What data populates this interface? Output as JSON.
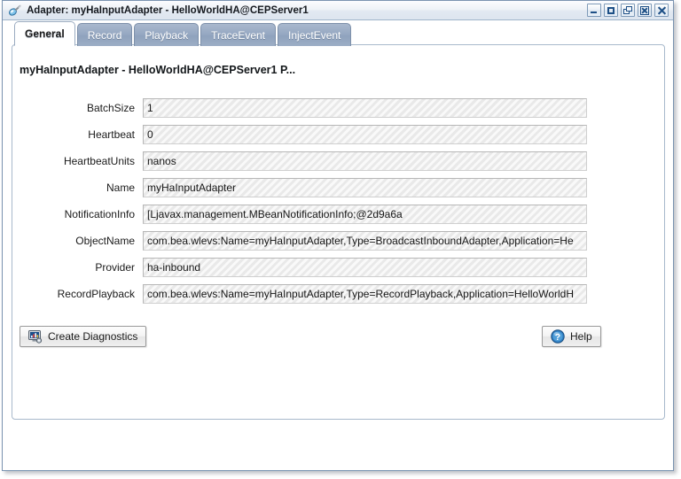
{
  "window": {
    "title": "Adapter: myHaInputAdapter - HelloWorldHA@CEPServer1",
    "icon": "adapter-plug-icon",
    "controls": [
      {
        "name": "minimize",
        "glyph": "minimize-icon"
      },
      {
        "name": "maximize",
        "glyph": "maximize-icon"
      },
      {
        "name": "restore",
        "glyph": "restore-icon"
      },
      {
        "name": "close-boxed",
        "glyph": "close-boxed-icon"
      },
      {
        "name": "close",
        "glyph": "close-icon"
      }
    ]
  },
  "tabs": [
    {
      "label": "General",
      "active": true
    },
    {
      "label": "Record",
      "active": false
    },
    {
      "label": "Playback",
      "active": false
    },
    {
      "label": "TraceEvent",
      "active": false
    },
    {
      "label": "InjectEvent",
      "active": false
    }
  ],
  "panel": {
    "heading": "myHaInputAdapter - HelloWorldHA@CEPServer1 P...",
    "fields": [
      {
        "label": "BatchSize",
        "value": "1"
      },
      {
        "label": "Heartbeat",
        "value": "0"
      },
      {
        "label": "HeartbeatUnits",
        "value": "nanos"
      },
      {
        "label": "Name",
        "value": "myHaInputAdapter"
      },
      {
        "label": "NotificationInfo",
        "value": "[Ljavax.management.MBeanNotificationInfo;@2d9a6a"
      },
      {
        "label": "ObjectName",
        "value": "com.bea.wlevs:Name=myHaInputAdapter,Type=BroadcastInboundAdapter,Application=He"
      },
      {
        "label": "Provider",
        "value": "ha-inbound"
      },
      {
        "label": "RecordPlayback",
        "value": "com.bea.wlevs:Name=myHaInputAdapter,Type=RecordPlayback,Application=HelloWorldH"
      }
    ],
    "buttons": {
      "create_diagnostics": "Create Diagnostics",
      "help": "Help"
    }
  },
  "colors": {
    "accent": "#1d4f86",
    "tab_inactive": "#97a9c3",
    "field_bg": "#e9e9e9",
    "border": "#7a93b0"
  }
}
